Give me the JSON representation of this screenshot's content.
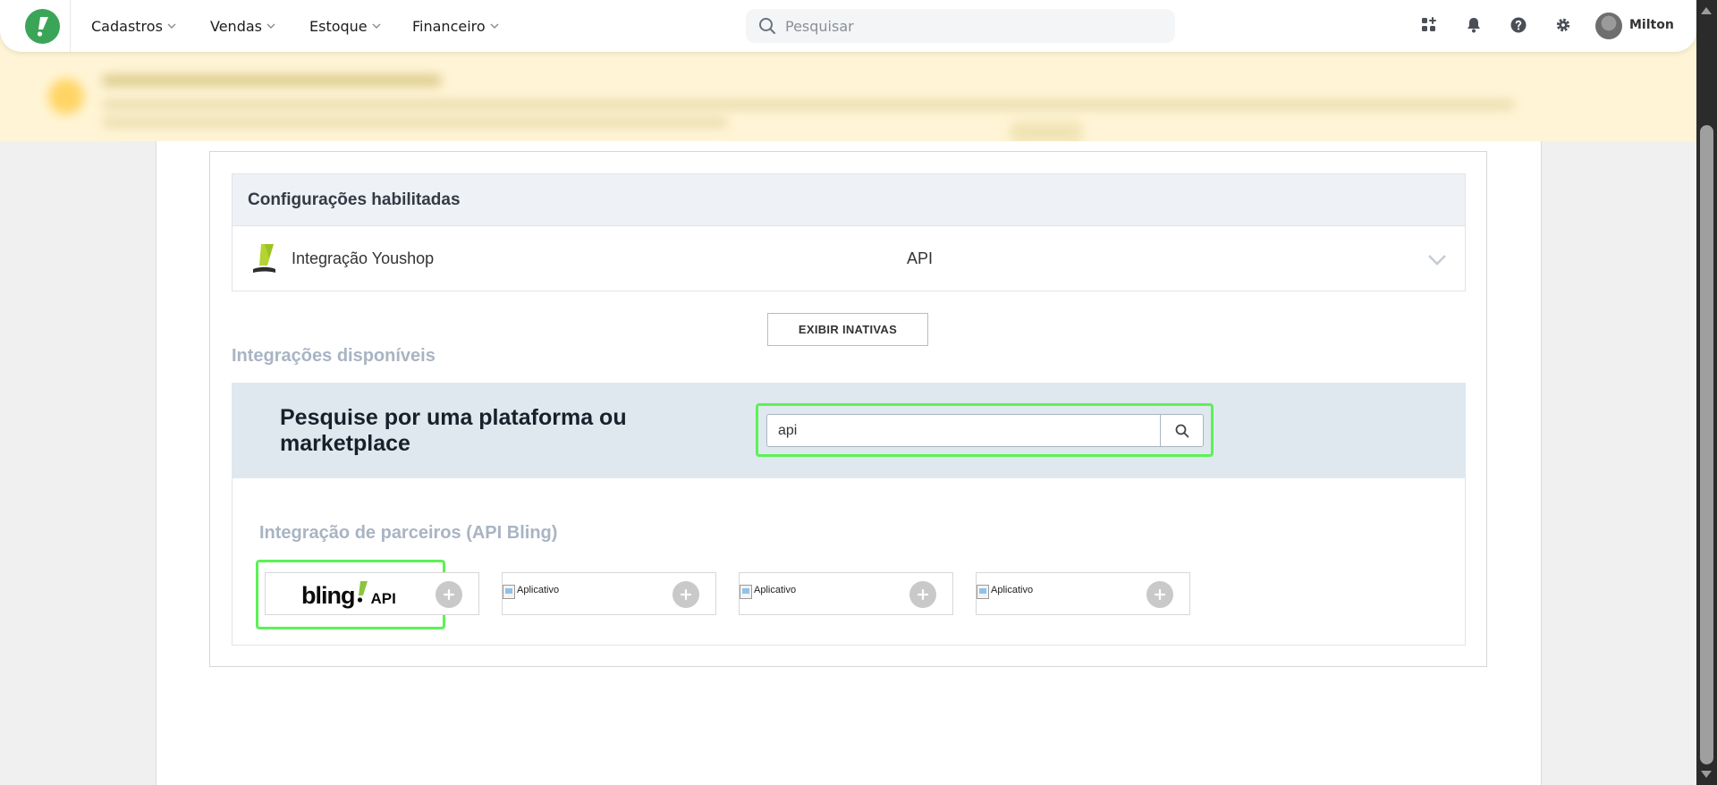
{
  "nav": {
    "items": [
      {
        "label": "Cadastros"
      },
      {
        "label": "Vendas"
      },
      {
        "label": "Estoque"
      },
      {
        "label": "Financeiro"
      }
    ],
    "search_placeholder": "Pesquisar",
    "user_name": "Milton"
  },
  "enabled": {
    "title": "Configurações habilitadas",
    "integration": {
      "name": "Integração Youshop",
      "type": "API"
    }
  },
  "show_inactive_label": "EXIBIR INATIVAS",
  "available_title": "Integrações disponíveis",
  "search_panel": {
    "title": "Pesquise por uma plataforma ou marketplace",
    "query": "api"
  },
  "partners": {
    "title": "Integração de parceiros (API Bling)",
    "bling_word": "bling",
    "bling_suffix": "API",
    "apps": [
      {
        "alt": "Aplicativo"
      },
      {
        "alt": "Aplicativo"
      },
      {
        "alt": "Aplicativo"
      }
    ]
  },
  "colors": {
    "brand_green": "#3ba557",
    "highlight_green": "#5cf255",
    "bling_green": "#8bc53f",
    "banner_bg": "#fff5d6",
    "search_panel_bg": "#dfe8ef"
  }
}
